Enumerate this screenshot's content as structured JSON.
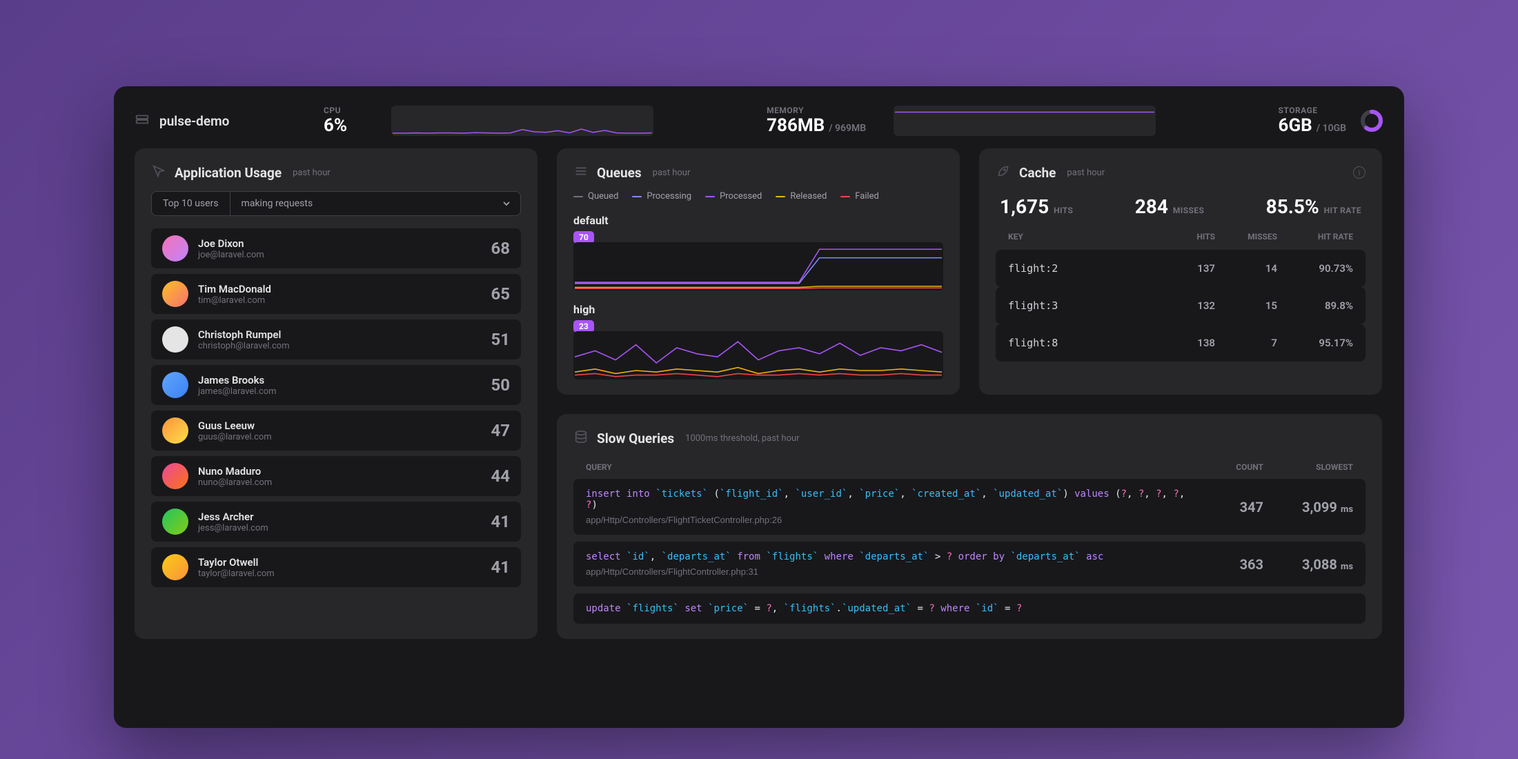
{
  "host": "pulse-demo",
  "cpu": {
    "label": "CPU",
    "value": "6%"
  },
  "memory": {
    "label": "MEMORY",
    "value": "786MB",
    "total": "/ 969MB"
  },
  "storage": {
    "label": "STORAGE",
    "value": "6GB",
    "total": "/ 10GB",
    "pct": 60
  },
  "usage": {
    "title": "Application Usage",
    "sub": "past hour",
    "tab_left": "Top 10 users",
    "tab_right": "making requests",
    "users": [
      {
        "name": "Joe Dixon",
        "email": "joe@laravel.com",
        "count": "68",
        "av": "av-a"
      },
      {
        "name": "Tim MacDonald",
        "email": "tim@laravel.com",
        "count": "65",
        "av": "av-b"
      },
      {
        "name": "Christoph Rumpel",
        "email": "christoph@laravel.com",
        "count": "51",
        "av": "av-c"
      },
      {
        "name": "James Brooks",
        "email": "james@laravel.com",
        "count": "50",
        "av": "av-d"
      },
      {
        "name": "Guus Leeuw",
        "email": "guus@laravel.com",
        "count": "47",
        "av": "av-e"
      },
      {
        "name": "Nuno Maduro",
        "email": "nuno@laravel.com",
        "count": "44",
        "av": "av-f"
      },
      {
        "name": "Jess Archer",
        "email": "jess@laravel.com",
        "count": "41",
        "av": "av-g"
      },
      {
        "name": "Taylor Otwell",
        "email": "taylor@laravel.com",
        "count": "41",
        "av": "av-h"
      }
    ]
  },
  "queues": {
    "title": "Queues",
    "sub": "past hour",
    "legend": [
      {
        "label": "Queued",
        "color": "#71717a"
      },
      {
        "label": "Processing",
        "color": "#818cf8"
      },
      {
        "label": "Processed",
        "color": "#a855f7"
      },
      {
        "label": "Released",
        "color": "#eab308"
      },
      {
        "label": "Failed",
        "color": "#ef4444"
      }
    ],
    "items": [
      {
        "name": "default",
        "badge": "70"
      },
      {
        "name": "high",
        "badge": "23"
      }
    ]
  },
  "cache": {
    "title": "Cache",
    "sub": "past hour",
    "stats": {
      "hits": "1,675",
      "hits_lbl": "HITS",
      "misses": "284",
      "misses_lbl": "MISSES",
      "rate": "85.5%",
      "rate_lbl": "HIT RATE"
    },
    "head": {
      "key": "KEY",
      "hits": "HITS",
      "misses": "MISSES",
      "rate": "HIT RATE"
    },
    "rows": [
      {
        "key": "flight:2",
        "hits": "137",
        "misses": "14",
        "rate": "90.73%"
      },
      {
        "key": "flight:3",
        "hits": "132",
        "misses": "15",
        "rate": "89.8%"
      },
      {
        "key": "flight:8",
        "hits": "138",
        "misses": "7",
        "rate": "95.17%"
      }
    ]
  },
  "slow": {
    "title": "Slow Queries",
    "sub": "1000ms threshold, past hour",
    "head": {
      "query": "QUERY",
      "count": "COUNT",
      "slowest": "SLOWEST"
    },
    "ms": "ms",
    "rows": [
      {
        "tokens": [
          {
            "t": "kw",
            "v": "insert into"
          },
          {
            "t": "",
            "v": " "
          },
          {
            "t": "str",
            "v": "`tickets`"
          },
          {
            "t": "",
            "v": " ("
          },
          {
            "t": "str",
            "v": "`flight_id`"
          },
          {
            "t": "",
            "v": ", "
          },
          {
            "t": "str",
            "v": "`user_id`"
          },
          {
            "t": "",
            "v": ", "
          },
          {
            "t": "str",
            "v": "`price`"
          },
          {
            "t": "",
            "v": ", "
          },
          {
            "t": "str",
            "v": "`created_at`"
          },
          {
            "t": "",
            "v": ", "
          },
          {
            "t": "str",
            "v": "`updated_at`"
          },
          {
            "t": "",
            "v": ") "
          },
          {
            "t": "kw",
            "v": "values"
          },
          {
            "t": "",
            "v": " ("
          },
          {
            "t": "qm",
            "v": "?"
          },
          {
            "t": "",
            "v": ", "
          },
          {
            "t": "qm",
            "v": "?"
          },
          {
            "t": "",
            "v": ", "
          },
          {
            "t": "qm",
            "v": "?"
          },
          {
            "t": "",
            "v": ", "
          },
          {
            "t": "qm",
            "v": "?"
          },
          {
            "t": "",
            "v": ", "
          },
          {
            "t": "qm",
            "v": "?"
          },
          {
            "t": "",
            "v": ")"
          }
        ],
        "loc": "app/Http/Controllers/FlightTicketController.php:26",
        "count": "347",
        "slow": "3,099"
      },
      {
        "tokens": [
          {
            "t": "kw",
            "v": "select"
          },
          {
            "t": "",
            "v": " "
          },
          {
            "t": "str",
            "v": "`id`"
          },
          {
            "t": "",
            "v": ", "
          },
          {
            "t": "str",
            "v": "`departs_at`"
          },
          {
            "t": "",
            "v": " "
          },
          {
            "t": "kw",
            "v": "from"
          },
          {
            "t": "",
            "v": " "
          },
          {
            "t": "str",
            "v": "`flights`"
          },
          {
            "t": "",
            "v": " "
          },
          {
            "t": "kw",
            "v": "where"
          },
          {
            "t": "",
            "v": " "
          },
          {
            "t": "str",
            "v": "`departs_at`"
          },
          {
            "t": "",
            "v": " > "
          },
          {
            "t": "qm",
            "v": "?"
          },
          {
            "t": "",
            "v": " "
          },
          {
            "t": "kw",
            "v": "order by"
          },
          {
            "t": "",
            "v": " "
          },
          {
            "t": "str",
            "v": "`departs_at`"
          },
          {
            "t": "",
            "v": " "
          },
          {
            "t": "kw",
            "v": "asc"
          }
        ],
        "loc": "app/Http/Controllers/FlightController.php:31",
        "count": "363",
        "slow": "3,088"
      },
      {
        "tokens": [
          {
            "t": "kw",
            "v": "update"
          },
          {
            "t": "",
            "v": " "
          },
          {
            "t": "str",
            "v": "`flights`"
          },
          {
            "t": "",
            "v": " "
          },
          {
            "t": "kw",
            "v": "set"
          },
          {
            "t": "",
            "v": " "
          },
          {
            "t": "str",
            "v": "`price`"
          },
          {
            "t": "",
            "v": " = "
          },
          {
            "t": "qm",
            "v": "?"
          },
          {
            "t": "",
            "v": ", "
          },
          {
            "t": "str",
            "v": "`flights`"
          },
          {
            "t": "",
            "v": "."
          },
          {
            "t": "str",
            "v": "`updated_at`"
          },
          {
            "t": "",
            "v": " = "
          },
          {
            "t": "qm",
            "v": "?"
          },
          {
            "t": "",
            "v": " "
          },
          {
            "t": "kw",
            "v": "where"
          },
          {
            "t": "",
            "v": " "
          },
          {
            "t": "str",
            "v": "`id`"
          },
          {
            "t": "",
            "v": " = "
          },
          {
            "t": "qm",
            "v": "?"
          }
        ],
        "loc": "",
        "count": "",
        "slow": ""
      }
    ]
  },
  "chart_data": {
    "cpu_spark": {
      "type": "line",
      "values": [
        5,
        5,
        6,
        5,
        6,
        6,
        5,
        7,
        6,
        5,
        6,
        18,
        10,
        8,
        14,
        6,
        20,
        8,
        15,
        6,
        5,
        5,
        6
      ],
      "ylim": [
        0,
        100
      ]
    },
    "mem_spark": {
      "type": "line",
      "values": [
        786,
        786,
        786,
        786,
        786,
        786,
        786,
        786,
        786,
        786,
        786,
        786
      ],
      "ylim": [
        0,
        969
      ]
    },
    "storage_donut": {
      "type": "pie",
      "used": 6,
      "total": 10
    },
    "queue_default": {
      "type": "line",
      "series": [
        {
          "name": "Processed",
          "color": "#a855f7",
          "values": [
            12,
            12,
            12,
            12,
            12,
            12,
            12,
            12,
            12,
            12,
            12,
            12,
            70,
            70,
            70,
            70,
            70,
            70,
            70
          ]
        },
        {
          "name": "Processing",
          "color": "#818cf8",
          "values": [
            10,
            10,
            10,
            10,
            10,
            10,
            10,
            10,
            10,
            10,
            10,
            10,
            55,
            55,
            55,
            55,
            55,
            55,
            55
          ]
        },
        {
          "name": "Released",
          "color": "#eab308",
          "values": [
            3,
            3,
            3,
            3,
            3,
            3,
            3,
            3,
            3,
            3,
            3,
            3,
            5,
            5,
            5,
            5,
            5,
            5,
            5
          ]
        },
        {
          "name": "Failed",
          "color": "#ef4444",
          "values": [
            1,
            1,
            1,
            1,
            1,
            1,
            1,
            1,
            1,
            1,
            1,
            1,
            2,
            2,
            2,
            2,
            2,
            2,
            2
          ]
        }
      ],
      "ylim": [
        0,
        80
      ]
    },
    "queue_high": {
      "type": "line",
      "series": [
        {
          "name": "Processed",
          "color": "#a855f7",
          "values": [
            14,
            18,
            12,
            22,
            10,
            20,
            16,
            14,
            24,
            12,
            18,
            20,
            16,
            23,
            15,
            20,
            18,
            22,
            17
          ]
        },
        {
          "name": "Released",
          "color": "#eab308",
          "values": [
            4,
            6,
            3,
            5,
            4,
            6,
            5,
            4,
            7,
            3,
            5,
            6,
            4,
            6,
            5,
            5,
            6,
            5,
            4
          ]
        },
        {
          "name": "Failed",
          "color": "#ef4444",
          "values": [
            2,
            3,
            1,
            2,
            2,
            3,
            2,
            1,
            3,
            2,
            2,
            3,
            2,
            3,
            2,
            2,
            3,
            2,
            2
          ]
        }
      ],
      "ylim": [
        0,
        30
      ]
    }
  }
}
